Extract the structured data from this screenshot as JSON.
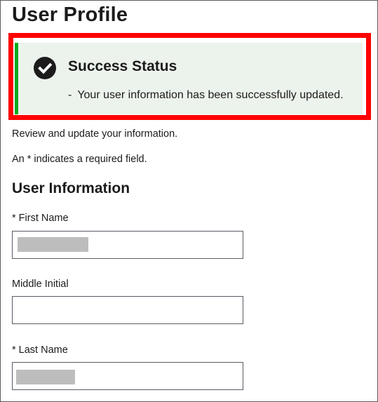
{
  "page": {
    "title": "User Profile"
  },
  "alert": {
    "icon": "check-circle-icon",
    "heading": "Success Status",
    "bullet": "-",
    "message": "Your user information has been successfully updated.",
    "colors": {
      "accent": "#00a91c",
      "background": "#ecf3ec",
      "highlight": "#ff0000"
    }
  },
  "intro": "Review and update your information.",
  "required_note": "An * indicates a required field.",
  "section": {
    "heading": "User Information"
  },
  "fields": {
    "first_name": {
      "label": "* First Name",
      "value": ""
    },
    "middle_initial": {
      "label": "Middle Initial",
      "value": ""
    },
    "last_name": {
      "label": "* Last Name",
      "value": ""
    }
  }
}
